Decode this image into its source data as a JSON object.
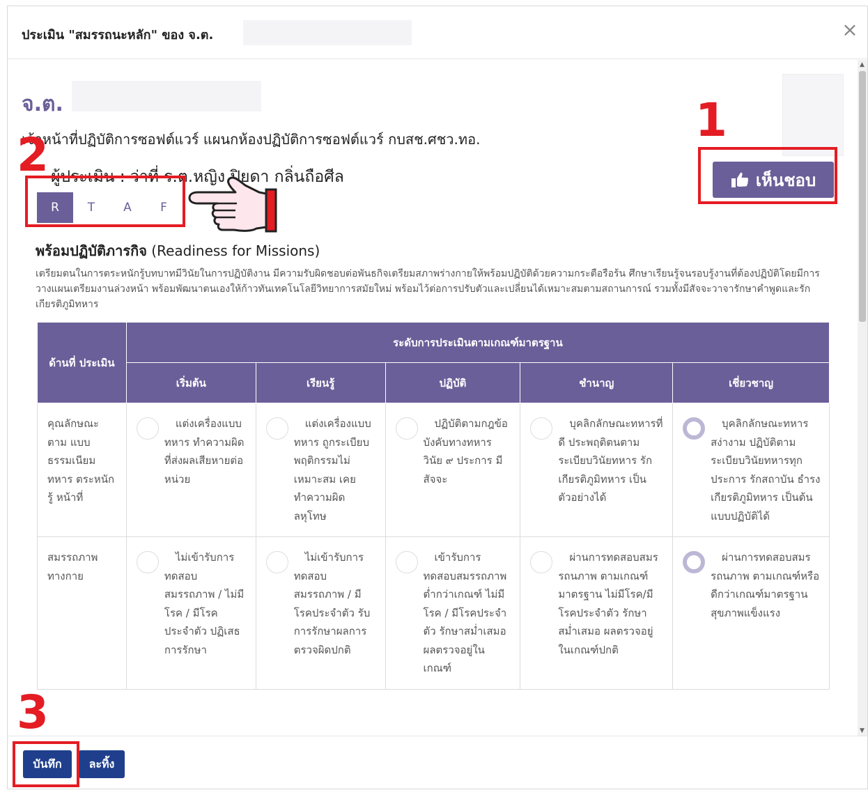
{
  "modal": {
    "title": "ประเมิน \"สมรรถนะหลัก\" ของ จ.ต.",
    "close_label": "×"
  },
  "profile": {
    "name_prefix": "จ.ต.",
    "position": "เจ้าหน้าที่ปฏิบัติการซอฟต์แวร์ แผนกห้องปฏิบัติการซอฟต์แวร์ กบสช.ศชว.ทอ.",
    "evaluator": "ผู้ประเมิน : ว่าที่ ร.ต.หญิง ปิยดา กลิ่นถือศีล",
    "like_label": "เห็นชอบ"
  },
  "tabs": [
    {
      "label": "R",
      "active": true
    },
    {
      "label": "T",
      "active": false
    },
    {
      "label": "A",
      "active": false
    },
    {
      "label": "F",
      "active": false
    }
  ],
  "section": {
    "title_th": "พร้อมปฏิบัติภารกิจ",
    "title_en": " (Readiness for Missions)",
    "description": "เตรียมตนในการตระหนักรู้บทบาทมีวินัยในการปฏิบัติงาน มีความรับผิดชอบต่อพันธกิจเตรียมสภาพร่างกายให้พร้อมปฏิบัติด้วยความกระตือรือร้น ศึกษาเรียนรู้จนรอบรู้งานที่ต้องปฏิบัติโดยมีการวางแผนเตรียมงานล่วงหน้า พร้อมพัฒนาตนเองให้ก้าวทันเทคโนโลยีวิทยาการสมัยใหม่ พร้อมไว้ต่อการปรับตัวและเปลี่ยนได้เหมาะสมตามสถานการณ์ รวมทั้งมีสัจจะวาจารักษาคำพูดและรักเกียรติภูมิทหาร"
  },
  "table": {
    "aspect_header": "ด้านที่ ประเมิน",
    "level_header": "ระดับการประเมินตามเกณฑ์มาตรฐาน",
    "levels": [
      "เริ่มต้น",
      "เรียนรู้",
      "ปฏิบัติ",
      "ชำนาญ",
      "เชี่ยวชาญ"
    ],
    "rows": [
      {
        "aspect": "คุณลักษณะ ตาม แบบ ธรรมเนียม ทหาร ตระหนักรู้ หน้าที่",
        "options": [
          {
            "text": "แต่งเครื่องแบบทหาร ทำความผิดที่ส่งผลเสียหายต่อหน่วย",
            "checked": false
          },
          {
            "text": "แต่งเครื่องแบบทหาร ถูกระเบียบ พฤติกรรมไม่เหมาะสม เคยทำความผิดลหุโทษ",
            "checked": false
          },
          {
            "text": "ปฏิบัติตามกฎข้อบังคับทางทหาร วินัย ๙ ประการ มีสัจจะ",
            "checked": false
          },
          {
            "text": "บุคลิกลักษณะทหารที่ดี ประพฤติตนตามระเบียบวินัยทหาร รักเกียรติภูมิทหาร เป็นตัวอย่างได้",
            "checked": false
          },
          {
            "text": "บุคลิกลักษณะทหารสง่างาม ปฏิบัติตามระเบียบวินัยทหารทุกประการ รักสถาบัน ธำรงเกียรติภูมิทหาร เป็นต้นแบบปฏิบัติได้",
            "checked": true
          }
        ]
      },
      {
        "aspect": "สมรรถภาพ ทางกาย",
        "options": [
          {
            "text": "ไม่เข้ารับการทดสอบสมรรถภาพ / ไม่มีโรค / มีโรคประจำตัว ปฏิเสธการรักษา",
            "checked": false
          },
          {
            "text": "ไม่เข้ารับการทดสอบสมรรถภาพ / มีโรคประจำตัว รับการรักษาผลการตรวจผิดปกติ",
            "checked": false
          },
          {
            "text": "เข้ารับการทดสอบสมรรถภาพ ต่ำกว่าเกณฑ์ ไม่มีโรค / มีโรคประจำตัว รักษาสม่ำเสมอ ผลตรวจอยู่ในเกณฑ์",
            "checked": false
          },
          {
            "text": "ผ่านการทดสอบสมรรถนภาพ ตามเกณฑ์มาตรฐาน ไม่มีโรค/มีโรคประจำตัว รักษาสม่ำเสมอ ผลตรวจอยู่ในเกณฑ์ปกติ",
            "checked": false
          },
          {
            "text": "ผ่านการทดสอบสมรรถนภาพ ตามเกณฑ์หรือดีกว่าเกณฑ์มาตรฐาน สุขภาพแข็งแรง",
            "checked": true
          }
        ]
      }
    ]
  },
  "footer": {
    "save_label": "บันทึก",
    "cancel_label": "ละทิ้ง"
  },
  "annotations": {
    "step1": "1",
    "step2": "2",
    "step3": "3",
    "color": "#e41c23"
  },
  "colors": {
    "accent": "#6b5f99",
    "footer_button": "#1f3f8c"
  }
}
